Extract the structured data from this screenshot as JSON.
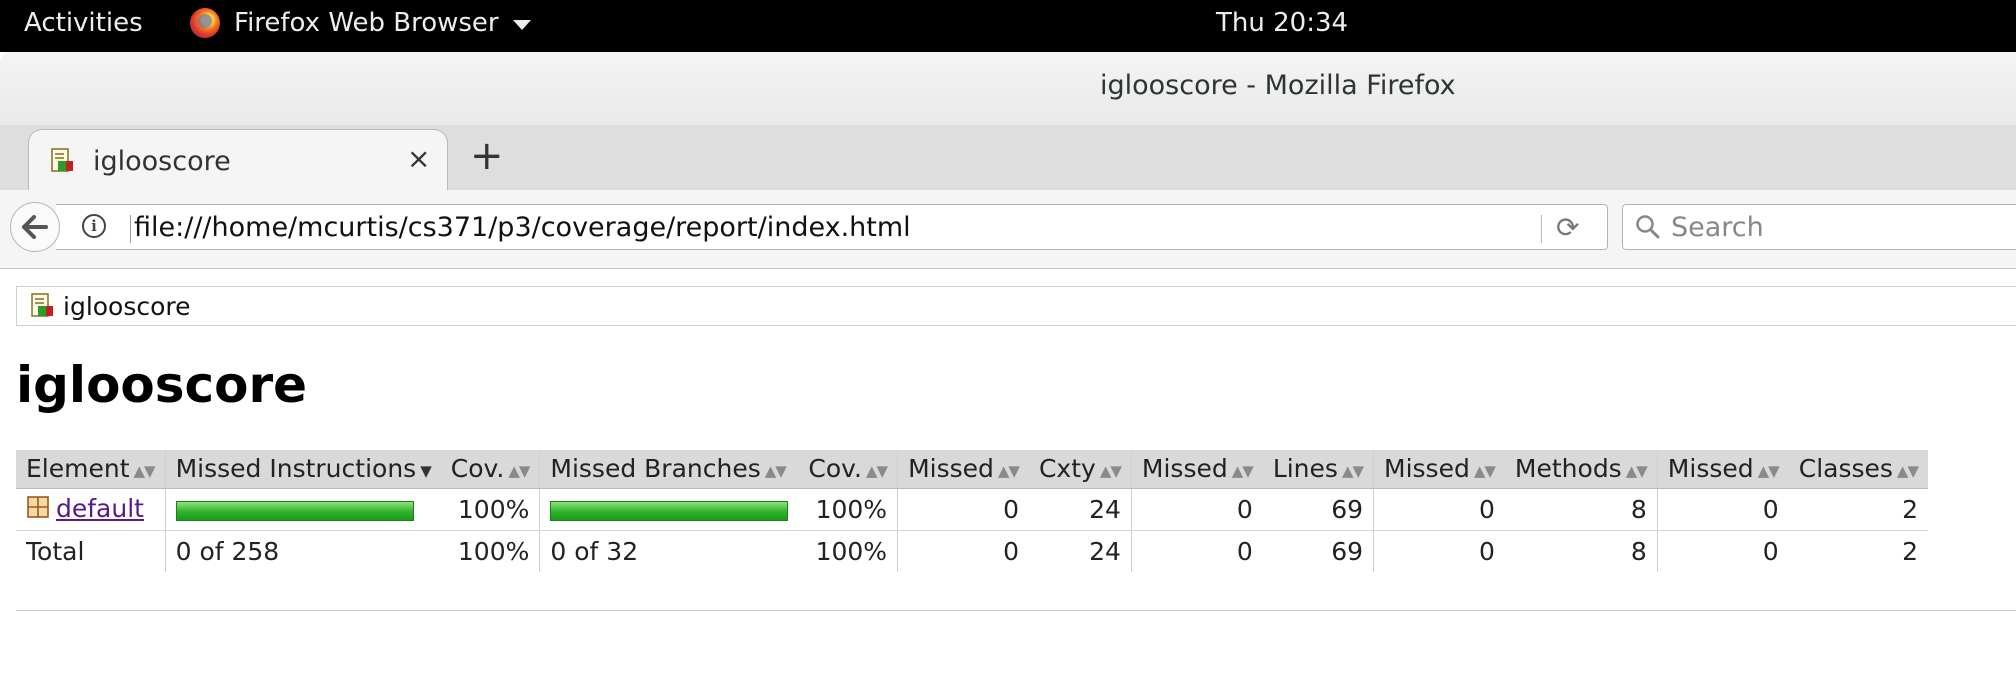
{
  "system_bar": {
    "activities": "Activities",
    "app_name": "Firefox Web Browser",
    "clock": "Thu 20:34"
  },
  "window": {
    "title": "iglooscore - Mozilla Firefox"
  },
  "tab": {
    "label": "iglooscore",
    "close": "×",
    "new_tab": "+"
  },
  "navbar": {
    "url": "file:///home/mcurtis/cs371/p3/coverage/report/index.html",
    "search_placeholder": "Search"
  },
  "breadcrumb": {
    "label": "iglooscore"
  },
  "page": {
    "title": "iglooscore"
  },
  "table": {
    "headers": {
      "element": "Element",
      "missed_instructions": "Missed Instructions",
      "cov1": "Cov.",
      "missed_branches": "Missed Branches",
      "cov2": "Cov.",
      "missed_cxty": "Missed",
      "cxty": "Cxty",
      "missed_lines": "Missed",
      "lines": "Lines",
      "missed_methods": "Missed",
      "methods": "Methods",
      "missed_classes": "Missed",
      "classes": "Classes"
    },
    "rows": [
      {
        "element": "default",
        "instructions_covered": 1.0,
        "cov1": "100%",
        "branches_covered": 1.0,
        "cov2": "100%",
        "missed_cxty": "0",
        "cxty": "24",
        "missed_lines": "0",
        "lines": "69",
        "missed_methods": "0",
        "methods": "8",
        "missed_classes": "0",
        "classes": "2"
      }
    ],
    "total": {
      "element": "Total",
      "missed_instructions": "0 of 258",
      "cov1": "100%",
      "missed_branches": "0 of 32",
      "cov2": "100%",
      "missed_cxty": "0",
      "cxty": "24",
      "missed_lines": "0",
      "lines": "69",
      "missed_methods": "0",
      "methods": "8",
      "missed_classes": "0",
      "classes": "2"
    }
  },
  "colors": {
    "bar_green": "#2eb32a",
    "header_gray": "#d9d9d9",
    "link_visited": "#551a8b"
  }
}
